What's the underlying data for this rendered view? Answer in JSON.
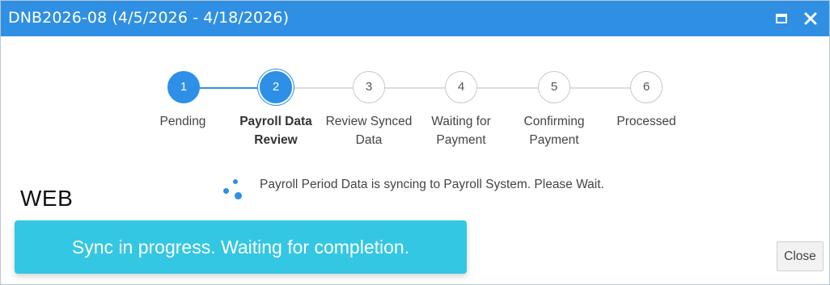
{
  "window": {
    "title": "DNB2026-08 (4/5/2026 - 4/18/2026)",
    "maximize_icon": "maximize-icon",
    "close_icon": "close-icon",
    "accent_color": "#2f8fe3"
  },
  "stepper": {
    "steps": [
      {
        "number": "1",
        "label": "Pending",
        "label_line2": "",
        "state": "done"
      },
      {
        "number": "2",
        "label": "Payroll Data",
        "label_line2": "Review",
        "state": "current"
      },
      {
        "number": "3",
        "label": "Review Synced",
        "label_line2": "Data",
        "state": "pending"
      },
      {
        "number": "4",
        "label": "Waiting for",
        "label_line2": "Payment",
        "state": "pending"
      },
      {
        "number": "5",
        "label": "Confirming",
        "label_line2": "Payment",
        "state": "pending"
      },
      {
        "number": "6",
        "label": "Processed",
        "label_line2": "",
        "state": "pending"
      }
    ],
    "active_color": "#2d8fe6"
  },
  "sync": {
    "spinner_icon": "loading-spinner-icon",
    "message": "Payroll Period Data is syncing to Payroll System. Please Wait."
  },
  "overlay": {
    "platform_label": "WEB",
    "banner_text": "Sync in progress. Waiting for completion.",
    "banner_color": "#33c7e3"
  },
  "footer": {
    "close_label": "Close"
  }
}
